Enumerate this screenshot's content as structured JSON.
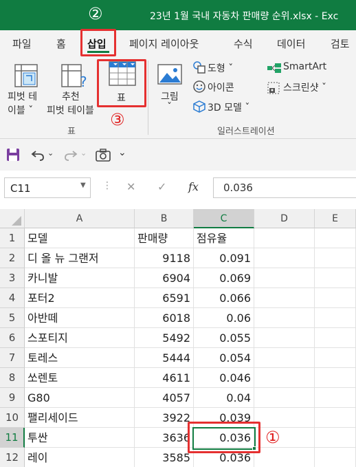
{
  "title_bar": {
    "file_title": "23년 1월 국내 자동차 판매량 순위.xlsx  -  Exc",
    "step_marker": "②"
  },
  "tabs": [
    "파일",
    "홈",
    "삽입",
    "페이지 레이아웃",
    "수식",
    "데이터",
    "검토"
  ],
  "active_tab": "삽입",
  "ribbon": {
    "pivot_table": {
      "line1": "피벗 테",
      "line2": "이블 ˇ"
    },
    "recommended_pivot": {
      "line1": "추천",
      "line2": "피벗 테이블"
    },
    "table_button": "표",
    "tables_group_label": "표",
    "step_marker": "③",
    "pictures": {
      "line1": "그림",
      "line2": "ˇ"
    },
    "shapes": "도형 ˇ",
    "icons": "아이콘",
    "models_3d": "3D 모델  ˇ",
    "smartart": "SmartArt",
    "screenshot": "스크린샷 ˇ",
    "illustrations_group_label": "일러스트레이션"
  },
  "formula_bar": {
    "name_box": "C11",
    "cancel_icon": "✕",
    "enter_icon": "✓",
    "fx_label": "fx",
    "value": "0.036"
  },
  "columns": [
    "A",
    "B",
    "C",
    "D",
    "E"
  ],
  "rows": [
    {
      "num": "1",
      "a": "모델",
      "b": "판매량",
      "c": "점유율"
    },
    {
      "num": "2",
      "a": "디 올 뉴 그랜저",
      "b": "9118",
      "c": "0.091"
    },
    {
      "num": "3",
      "a": "카니발",
      "b": "6904",
      "c": "0.069"
    },
    {
      "num": "4",
      "a": "포터2",
      "b": "6591",
      "c": "0.066"
    },
    {
      "num": "5",
      "a": "아반떼",
      "b": "6018",
      "c": "0.06"
    },
    {
      "num": "6",
      "a": "스포티지",
      "b": "5492",
      "c": "0.055"
    },
    {
      "num": "7",
      "a": "토레스",
      "b": "5444",
      "c": "0.054"
    },
    {
      "num": "8",
      "a": "쏘렌토",
      "b": "4611",
      "c": "0.046"
    },
    {
      "num": "9",
      "a": "G80",
      "b": "4057",
      "c": "0.04"
    },
    {
      "num": "10",
      "a": "팰리세이드",
      "b": "3922",
      "c": "0.039"
    },
    {
      "num": "11",
      "a": "투싼",
      "b": "3636",
      "c": "0.036"
    },
    {
      "num": "12",
      "a": "레이",
      "b": "3585",
      "c": "0.036"
    }
  ],
  "selected_cell_marker": "①",
  "colors": {
    "excel_green": "#107c41",
    "annotation_red": "#e53030"
  }
}
